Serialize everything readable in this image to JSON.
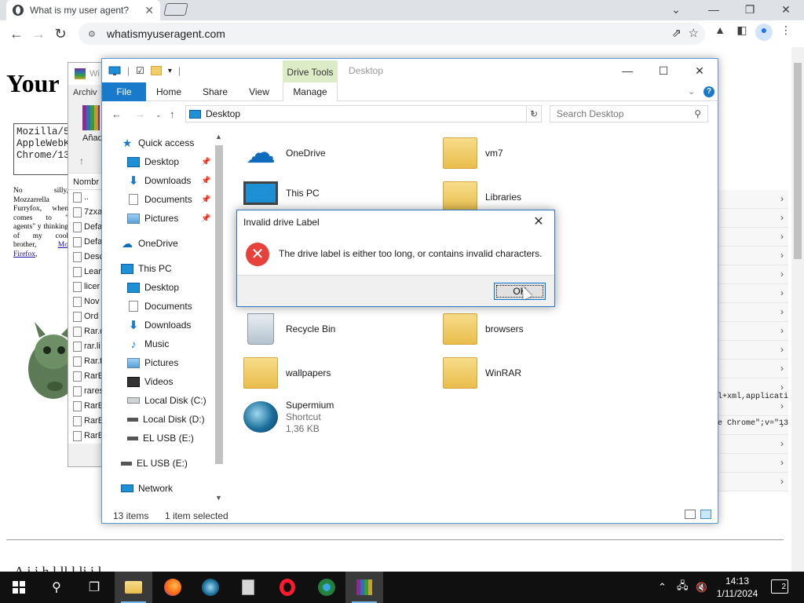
{
  "browser": {
    "tab_title": "What is my user agent?",
    "url": "whatismyuseragent.com",
    "icons": [
      "back-arrow-icon",
      "forward-arrow-icon",
      "reload-icon",
      "site-settings-icon",
      "share-icon",
      "bookmark-star-icon",
      "extensions-icon",
      "side-panel-icon",
      "profile-icon",
      "menu-icon"
    ]
  },
  "webpage": {
    "heading": "Your",
    "ua_lines": [
      "Mozilla/5",
      "AppleWebK",
      "Chrome/13"
    ],
    "paragraph_text": "No silly, Mozzarrella Furryfox, when comes to \" agents\" y thinking of my cool brother, ",
    "paragraph_link": "Mo",
    "paragraph_link2": "Firefox",
    "code_1": "l+xml,applicati",
    "code_2": "e Chrome\";v=\"13",
    "bottom_text": "A     i     i         h     l  ll    l    li     i    l"
  },
  "winrar": {
    "title": "Wi",
    "menu": "Archiv",
    "tool_label": "Añad",
    "column_header": "Nombr",
    "files": [
      "..",
      "7zxa",
      "Defa",
      "Defa",
      "Desc",
      "Lear",
      "licer",
      "Nov",
      "Ord",
      "Rar.d",
      "rar.li",
      "Rar.t",
      "RarE",
      "rares",
      "RarE",
      "RarE",
      "RarE"
    ]
  },
  "explorer": {
    "contextual_group": "Drive Tools",
    "title": "Desktop",
    "ribbon_tabs": [
      "File",
      "Home",
      "Share",
      "View",
      "Manage"
    ],
    "address": "Desktop",
    "search_placeholder": "Search Desktop",
    "nav_pane": {
      "quick_access": "Quick access",
      "qa_desktop": "Desktop",
      "qa_downloads": "Downloads",
      "qa_documents": "Documents",
      "qa_pictures": "Pictures",
      "onedrive": "OneDrive",
      "this_pc": "This PC",
      "pc_desktop": "Desktop",
      "pc_documents": "Documents",
      "pc_downloads": "Downloads",
      "pc_music": "Music",
      "pc_pictures": "Pictures",
      "pc_videos": "Videos",
      "local_c": "Local Disk (C:)",
      "local_d": "Local Disk (D:)",
      "usb_e_sub": "EL USB (E:)",
      "usb_e": "EL USB (E:)",
      "network": "Network"
    },
    "items": {
      "onedrive": "OneDrive",
      "vm7": "vm7",
      "this_pc": "This PC",
      "libraries": "Libraries",
      "recycle_bin": "Recycle Bin",
      "browsers": "browsers",
      "wallpapers": "wallpapers",
      "winrar": "WinRAR",
      "supermium": "Supermium",
      "supermium_type": "Shortcut",
      "supermium_size": "1,36 KB"
    },
    "status_count": "13 items",
    "status_selected": "1 item selected"
  },
  "dialog": {
    "title": "Invalid drive Label",
    "message": "The drive label is either too long, or contains invalid characters.",
    "ok_label": "OK"
  },
  "taskbar": {
    "time": "14:13",
    "date": "1/11/2024",
    "notification_count": "2",
    "apps": [
      "file-explorer",
      "firefox",
      "supermium",
      "document",
      "opera",
      "chrome-variant",
      "winrar"
    ]
  }
}
